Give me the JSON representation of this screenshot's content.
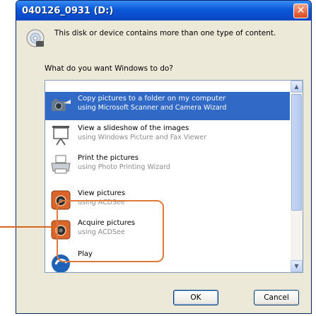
{
  "window": {
    "title": "040126_0931 (D:)",
    "close_glyph": "✕"
  },
  "message": {
    "text": "This disk or device contains more than one type of content.",
    "question": "What do you want Windows to do?"
  },
  "actions": [
    {
      "line1": "Copy pictures to a folder on my computer",
      "line2": "using Microsoft Scanner and Camera Wizard",
      "icon": "camera-copy-icon",
      "selected": true
    },
    {
      "line1": "View a slideshow of the images",
      "line2": "using Windows Picture and Fax Viewer",
      "icon": "slideshow-icon",
      "selected": false
    },
    {
      "line1": "Print the pictures",
      "line2": "using Photo Printing Wizard",
      "icon": "printer-icon",
      "selected": false
    },
    {
      "line1": "View pictures",
      "line2": "using ACDSee",
      "icon": "acdsee-icon",
      "selected": false
    },
    {
      "line1": "Acquire pictures",
      "line2": "using ACDSee",
      "icon": "acdsee-icon",
      "selected": false
    },
    {
      "line1": "Play",
      "line2": "",
      "icon": "play-icon",
      "selected": false
    }
  ],
  "scroll": {
    "up_glyph": "▲",
    "down_glyph": "▼"
  },
  "buttons": {
    "ok": "OK",
    "cancel": "Cancel"
  },
  "colors": {
    "selection": "#3169C6",
    "highlight": "#E07A3C",
    "titlebar": "#0A58D8"
  }
}
